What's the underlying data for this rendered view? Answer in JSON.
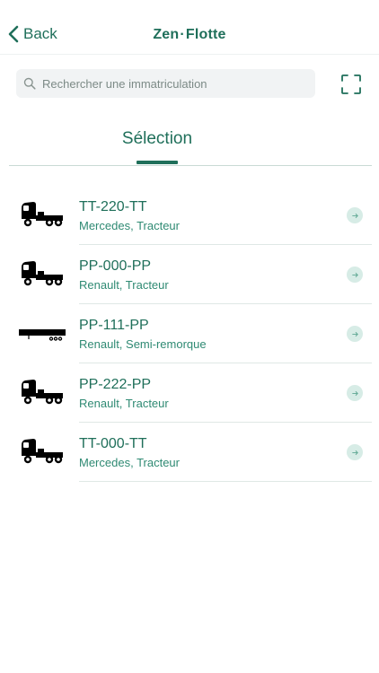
{
  "nav": {
    "back_label": "Back",
    "title_part1": "Zen",
    "title_sep": "·",
    "title_part2": "Flotte"
  },
  "search": {
    "placeholder": "Rechercher une immatriculation"
  },
  "section": {
    "title": "Sélection"
  },
  "vehicles": [
    {
      "plate": "TT-220-TT",
      "desc": "Mercedes, Tracteur",
      "icon": "truck-tractor-icon"
    },
    {
      "plate": "PP-000-PP",
      "desc": "Renault, Tracteur",
      "icon": "truck-tractor-icon"
    },
    {
      "plate": "PP-111-PP",
      "desc": "Renault, Semi-remorque",
      "icon": "semi-trailer-icon"
    },
    {
      "plate": "PP-222-PP",
      "desc": "Renault, Tracteur",
      "icon": "truck-tractor-icon"
    },
    {
      "plate": "TT-000-TT",
      "desc": "Mercedes, Tracteur",
      "icon": "truck-tractor-icon"
    }
  ],
  "colors": {
    "accent": "#1f6f5a",
    "secondary": "#2f8a73",
    "chip": "#d7ece6",
    "search_bg": "#f1f3f4"
  }
}
